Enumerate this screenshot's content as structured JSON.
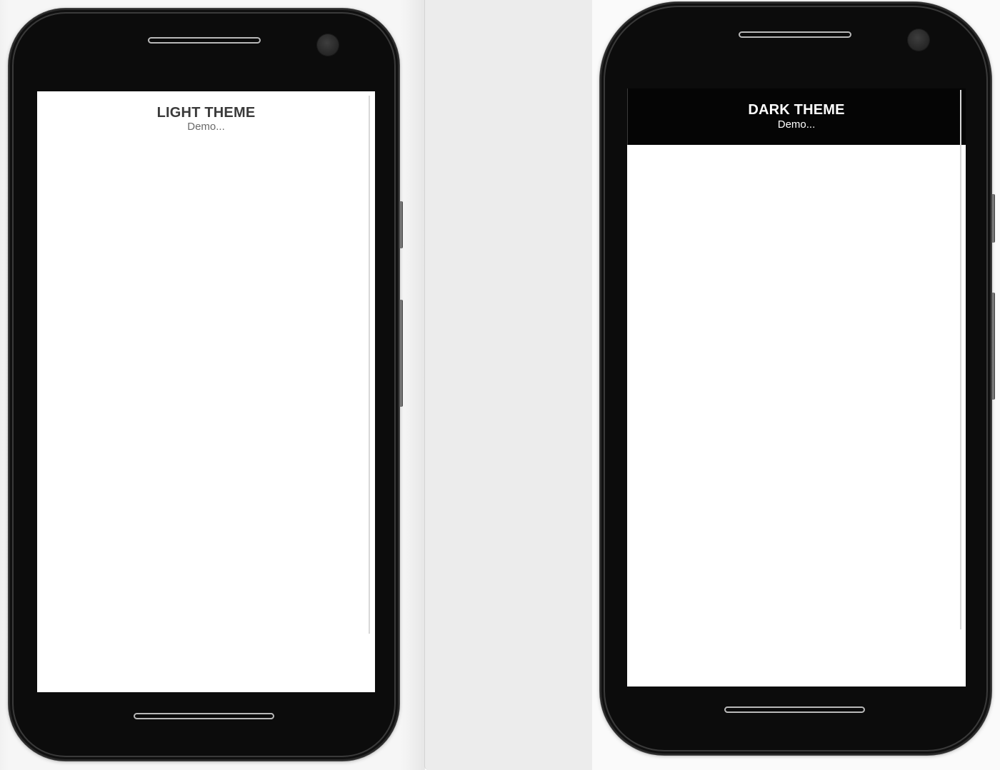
{
  "phones": {
    "light": {
      "title": "LIGHT THEME",
      "subtitle": "Demo..."
    },
    "dark": {
      "title": "DARK THEME",
      "subtitle": "Demo..."
    }
  },
  "colors": {
    "phone_body": "#0c0c0c",
    "screen_background": "#ffffff",
    "dark_header_background": "#050505",
    "workspace_background": "#ececec"
  }
}
